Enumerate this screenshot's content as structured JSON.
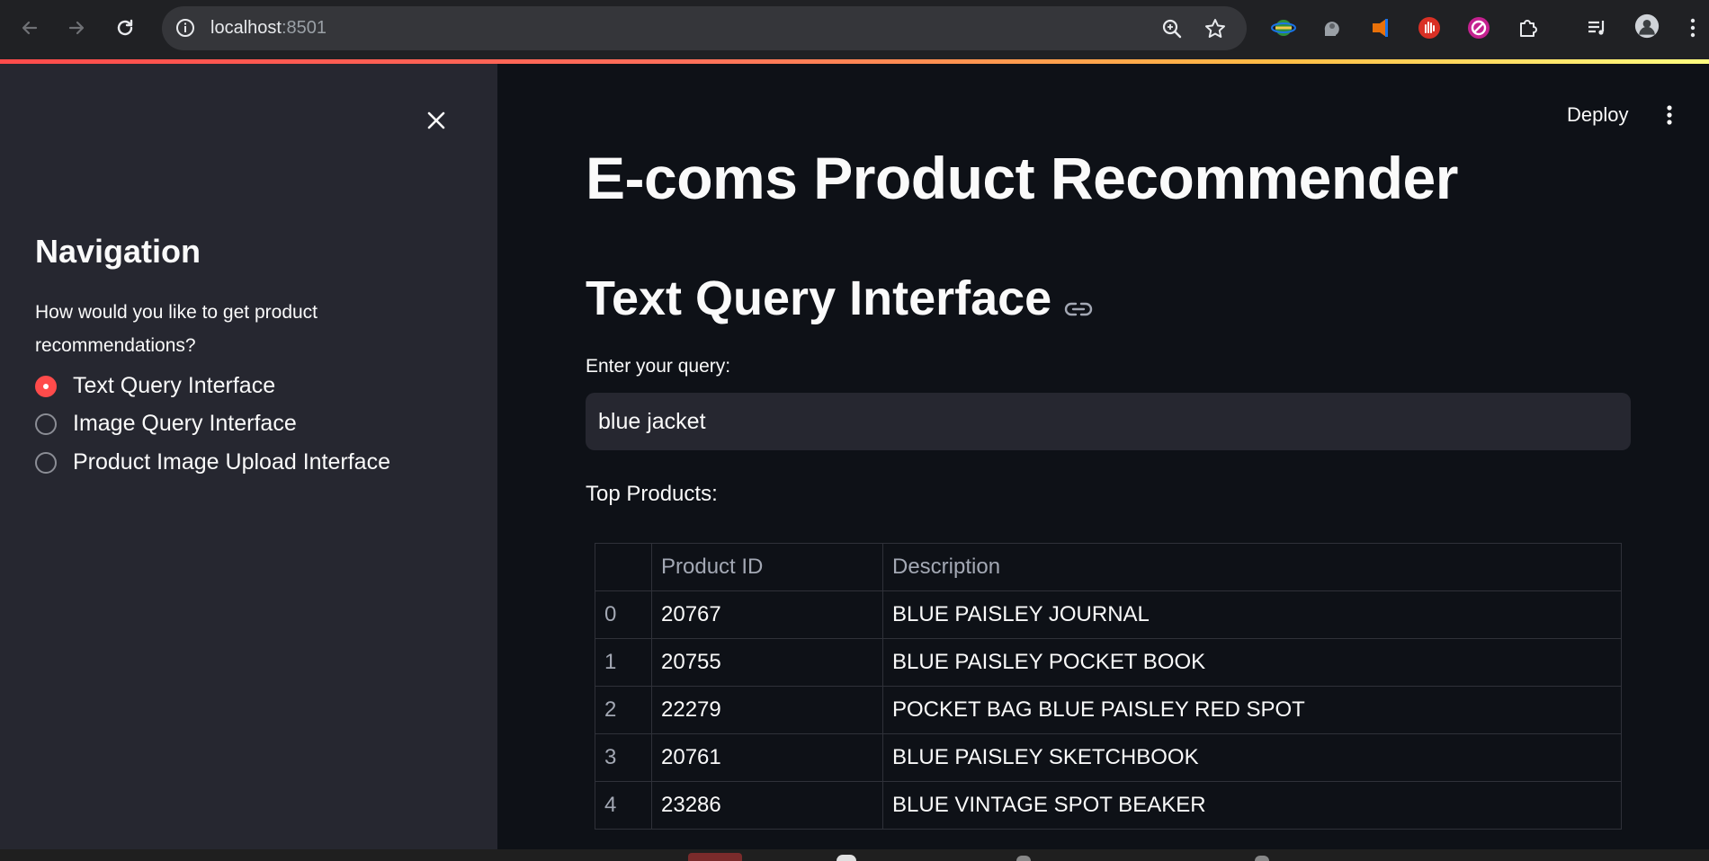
{
  "browser": {
    "url_host": "localhost",
    "url_port": ":8501"
  },
  "sidebar": {
    "title": "Navigation",
    "question": "How would you like to get product recommendations?",
    "options": [
      {
        "label": "Text Query Interface",
        "selected": true
      },
      {
        "label": "Image Query Interface",
        "selected": false
      },
      {
        "label": "Product Image Upload Interface",
        "selected": false
      }
    ]
  },
  "header": {
    "deploy_label": "Deploy"
  },
  "main": {
    "page_title": "E-coms Product Recommender",
    "section_title": "Text Query Interface",
    "query_label": "Enter your query:",
    "query_value": "blue jacket",
    "results_label": "Top Products:",
    "table": {
      "columns": [
        "",
        "Product ID",
        "Description"
      ],
      "rows": [
        [
          "0",
          "20767",
          "BLUE PAISLEY JOURNAL"
        ],
        [
          "1",
          "20755",
          "BLUE PAISLEY POCKET BOOK"
        ],
        [
          "2",
          "22279",
          "POCKET BAG BLUE PAISLEY RED SPOT"
        ],
        [
          "3",
          "20761",
          "BLUE PAISLEY SKETCHBOOK"
        ],
        [
          "4",
          "23286",
          "BLUE VINTAGE SPOT BEAKER"
        ]
      ]
    }
  },
  "colors": {
    "accent": "#ff4b4b",
    "sidebar_bg": "#262730",
    "main_bg": "#0e1117"
  }
}
